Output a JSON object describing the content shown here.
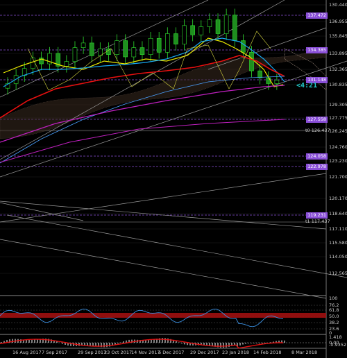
{
  "price_axis": {
    "ticks": [
      "130.440",
      "136.955",
      "135.845",
      "133.895",
      "132.365",
      "130.835",
      "129.305",
      "127.775",
      "126.245",
      "124.760",
      "123.230",
      "121.700",
      "120.170",
      "118.640",
      "117.110",
      "115.580",
      "114.050",
      "112.565"
    ],
    "tags": [
      {
        "text": "137.472",
        "color": "#8a4fd8"
      },
      {
        "text": "134.385",
        "color": "#8a4fd8"
      },
      {
        "text": "131.148",
        "color": "#8a4fd8"
      },
      {
        "text": "127.558",
        "color": "#8a4fd8"
      },
      {
        "text": "124.058",
        "color": "#8a4fd8"
      },
      {
        "text": "122.978",
        "color": "#8a4fd8"
      },
      {
        "text": "119.231",
        "color": "#8a4fd8"
      }
    ]
  },
  "side_labels": {
    "t0": "t0 126.437",
    "t1": "t1 117.437"
  },
  "countdown": "<4:21",
  "rsi_axis": {
    "ticks": [
      "100",
      "76.2",
      "61.8",
      "50.0",
      "38.2",
      "23.6",
      "0"
    ]
  },
  "macd_axis": {
    "ticks": [
      "1.418",
      "0.00",
      "-0.9352"
    ]
  },
  "time_axis": {
    "labels": [
      "16 Aug 2017",
      "7 Sep 2017",
      "29 Sep 2017",
      "23 Oct 2017",
      "14 Nov 2017",
      "6 Dec 2017",
      "29 Dec 2017",
      "23 Jan 2018",
      "14 Feb 2018",
      "8 Mar 2018"
    ]
  },
  "colors": {
    "bull": "#22c422",
    "bear": "#22c422",
    "ma_red": "#e81010",
    "ma_yellow": "#e8e800",
    "ma_cyan": "#17a7f0",
    "ma_magenta": "#c020c0",
    "grid": "#1a1a1a",
    "level": "#8a4fd8"
  },
  "chart_data": {
    "type": "candlestick",
    "symbol_timeframe": "",
    "ylim": [
      112.565,
      137.9
    ],
    "x_dates": [
      "16 Aug 2017",
      "7 Sep 2017",
      "29 Sep 2017",
      "23 Oct 2017",
      "14 Nov 2017",
      "6 Dec 2017",
      "29 Dec 2017",
      "23 Jan 2018",
      "14 Feb 2018",
      "8 Mar 2018"
    ],
    "close_approx": [
      130.7,
      131.4,
      132.0,
      132.9,
      132.4,
      133.3,
      132.2,
      132.6,
      133.8,
      134.2,
      133.1,
      133.7,
      133.2,
      134.4,
      133.0,
      133.8,
      133.2,
      134.6,
      133.4,
      135.0,
      134.1,
      135.7,
      134.9,
      135.6,
      136.2,
      135.0,
      136.6,
      134.4,
      133.4,
      131.8,
      131.2,
      130.7,
      131.0
    ]
  }
}
